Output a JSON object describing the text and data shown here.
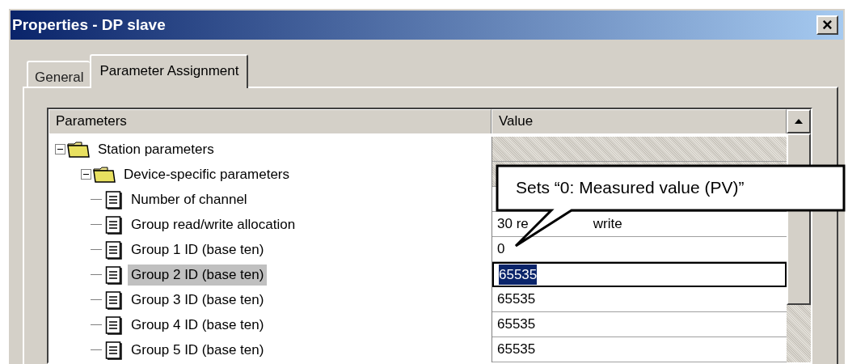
{
  "window": {
    "title": "Properties - DP slave",
    "close_label": "×"
  },
  "tabs": [
    {
      "label": "General",
      "selected": false
    },
    {
      "label": "Parameter Assignment",
      "selected": true
    }
  ],
  "table": {
    "columns": [
      "Parameters",
      "Value"
    ],
    "rows": [
      {
        "kind": "folder",
        "label": "Station parameters",
        "expanded": true,
        "selected": false,
        "children": [
          {
            "kind": "folder",
            "label": "Device-specific parameters",
            "expanded": true,
            "selected": false,
            "children": [
              {
                "kind": "leaf",
                "label": "Number of channel",
                "selected": false
              },
              {
                "kind": "leaf",
                "label": "Group read/write allocation",
                "value_parts": [
                  "30 re",
                  "write"
                ],
                "selected": false
              },
              {
                "kind": "leaf",
                "label": "Group 1 ID (base ten)",
                "value_parts": [
                  "0"
                ],
                "selected": false
              },
              {
                "kind": "leaf",
                "label": "Group 2 ID (base ten)",
                "value_parts": [
                  "65535"
                ],
                "selected": true
              },
              {
                "kind": "leaf",
                "label": "Group 3 ID (base ten)",
                "value_parts": [
                  "65535"
                ],
                "selected": false
              },
              {
                "kind": "leaf",
                "label": "Group 4 ID (base ten)",
                "value_parts": [
                  "65535"
                ],
                "selected": false
              },
              {
                "kind": "leaf",
                "label": "Group 5 ID (base ten)",
                "value_parts": [
                  "65535"
                ],
                "selected": false
              }
            ]
          }
        ]
      }
    ]
  },
  "callout": {
    "text": "Sets “0: Measured value (PV)”"
  }
}
